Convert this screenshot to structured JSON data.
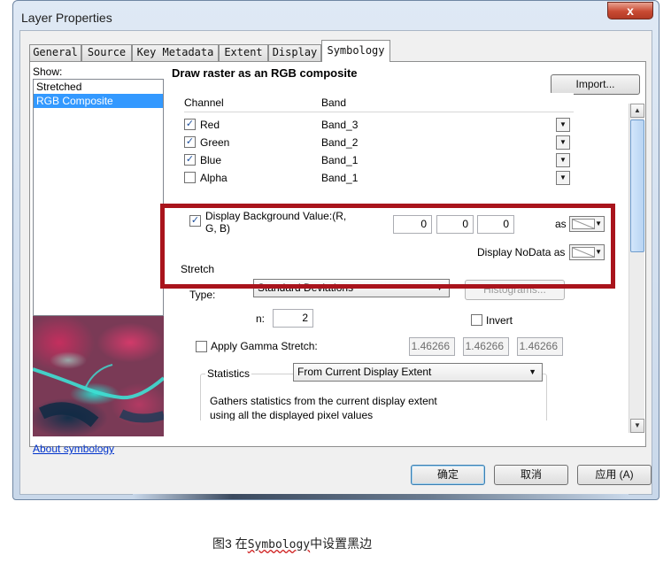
{
  "window": {
    "title": "Layer Properties",
    "close_glyph": "x"
  },
  "tabs": [
    {
      "label": "General"
    },
    {
      "label": "Source"
    },
    {
      "label": "Key Metadata"
    },
    {
      "label": "Extent"
    },
    {
      "label": "Display"
    },
    {
      "label": "Symbology"
    }
  ],
  "show": {
    "label": "Show:",
    "items": [
      "Stretched",
      "RGB Composite"
    ],
    "selected": "RGB Composite",
    "about_link": "About symbology"
  },
  "panel": {
    "heading": "Draw raster as an RGB composite",
    "import_button": "Import..."
  },
  "channel_table": {
    "headers": [
      "Channel",
      "Band"
    ],
    "rows": [
      {
        "channel": "Red",
        "band": "Band_3",
        "checked": true
      },
      {
        "channel": "Green",
        "band": "Band_2",
        "checked": true
      },
      {
        "channel": "Blue",
        "band": "Band_1",
        "checked": true
      },
      {
        "channel": "Alpha",
        "band": "Band_1",
        "checked": false
      }
    ]
  },
  "background": {
    "checkbox_label_1": "Display Background Value:(R,",
    "checkbox_label_2": "G, B)",
    "checked": true,
    "r": "0",
    "g": "0",
    "b": "0",
    "as_label": "as",
    "nodata_label": "Display NoData as"
  },
  "stretch": {
    "section_label": "Stretch",
    "type_label": "Type:",
    "type_value": "Standard Deviations",
    "histograms_button": "Histograms...",
    "n_label": "n:",
    "n_value": "2",
    "invert_label": "Invert",
    "gamma_label": "Apply Gamma Stretch:",
    "gamma_values": [
      "1.46266",
      "1.46266",
      "1.46266"
    ],
    "statistics_label": "Statistics",
    "statistics_value": "From Current Display Extent",
    "statistics_desc_1": "Gathers statistics from the current display extent",
    "statistics_desc_2": "using all the displayed pixel values"
  },
  "buttons": {
    "ok": "确定",
    "cancel": "取消",
    "apply": "应用 (A)"
  },
  "caption": {
    "prefix": "图3  在",
    "middle": "Symbology",
    "suffix": "中设置黑边"
  },
  "colors": {
    "highlight": "#a9141c",
    "selection": "#3399ff",
    "link": "#0033cc"
  }
}
